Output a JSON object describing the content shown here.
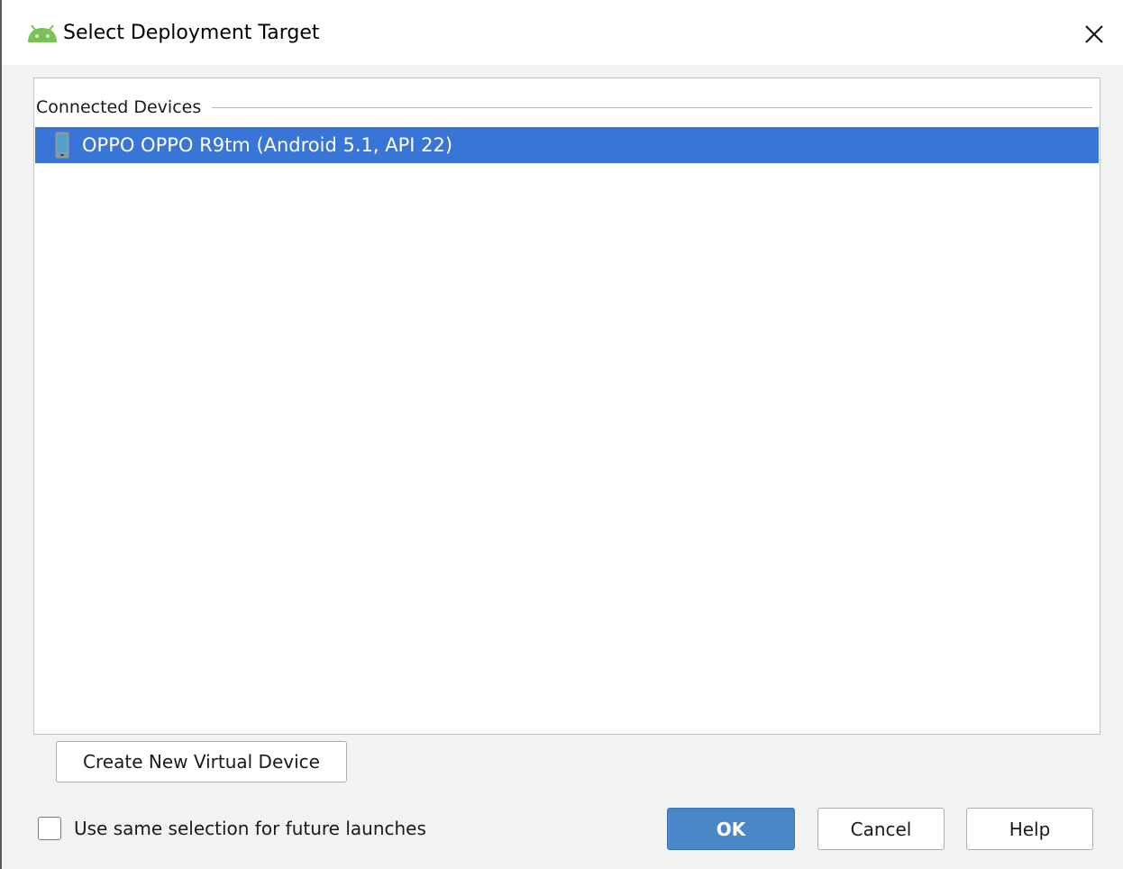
{
  "dialog": {
    "title": "Select Deployment Target"
  },
  "icons": {
    "app": "android-icon",
    "close": "close-icon",
    "device": "phone-icon"
  },
  "colors": {
    "selection": "#3875d7",
    "ok_button": "#4a86c8",
    "android_green": "#78c257"
  },
  "devices": {
    "section_label": "Connected Devices",
    "items": [
      {
        "label": "OPPO OPPO R9tm (Android 5.1, API 22)",
        "selected": true
      }
    ]
  },
  "buttons": {
    "create_virtual": "Create New Virtual Device",
    "ok": "OK",
    "cancel": "Cancel",
    "help": "Help"
  },
  "options": {
    "future_label": "Use same selection for future launches",
    "future_checked": false
  }
}
